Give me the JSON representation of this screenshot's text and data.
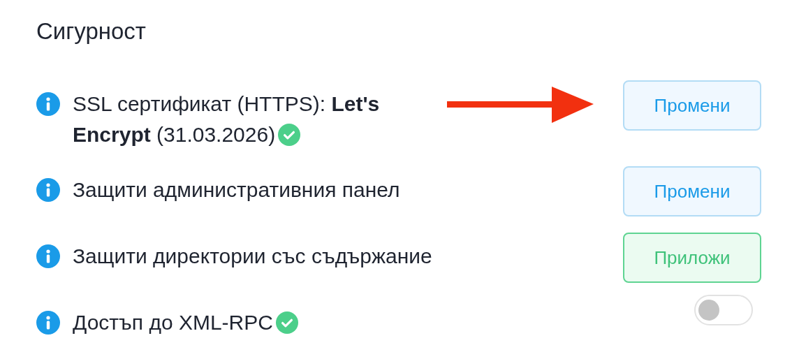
{
  "section": {
    "title": "Сигурност"
  },
  "rows": [
    {
      "kind": "button",
      "text": "SSL сертификат (HTTPS): **Let's Encrypt** (31.03.2026)",
      "verified": true,
      "button": {
        "label": "Промени",
        "kind": "change"
      },
      "pointer_arrow": true
    },
    {
      "kind": "button",
      "text": "Защити административния панел",
      "verified": false,
      "button": {
        "label": "Промени",
        "kind": "change"
      },
      "pointer_arrow": false
    },
    {
      "kind": "button",
      "text": "Защити директории със съдържание",
      "verified": false,
      "button": {
        "label": "Приложи",
        "kind": "apply"
      },
      "pointer_arrow": false
    },
    {
      "kind": "toggle",
      "text": "Достъп до XML-RPC",
      "verified": true,
      "on": false,
      "pointer_arrow": false
    }
  ]
}
